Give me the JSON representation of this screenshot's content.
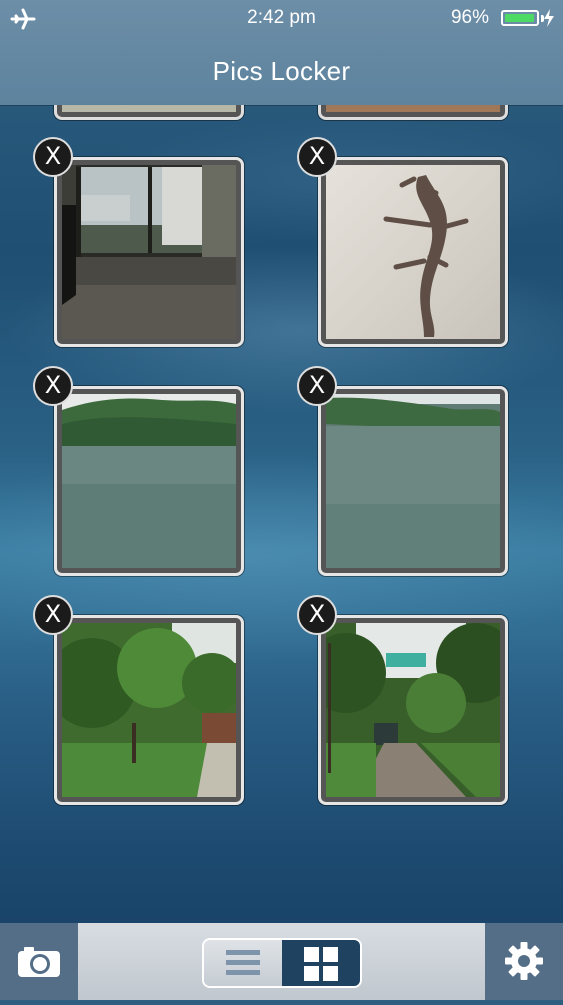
{
  "status_bar": {
    "time": "2:42 pm",
    "battery_percent": "96%",
    "battery_level": 0.96,
    "icons": [
      "airplane-mode-icon",
      "battery-icon",
      "charging-bolt-icon"
    ]
  },
  "nav": {
    "title": "Pics Locker"
  },
  "photos": [
    {
      "label": "room with window",
      "delete_label": "X"
    },
    {
      "label": "gecko on wall",
      "delete_label": "X"
    },
    {
      "label": "lake with hills",
      "delete_label": "X"
    },
    {
      "label": "lake shore",
      "delete_label": "X"
    },
    {
      "label": "garden with trees",
      "delete_label": "X"
    },
    {
      "label": "driveway with car",
      "delete_label": "X"
    }
  ],
  "toolbar": {
    "camera_icon": "camera-icon",
    "list_view_icon": "list-view-icon",
    "grid_view_icon": "grid-view-icon",
    "selected_view": "grid",
    "settings_icon": "gear-icon"
  },
  "colors": {
    "nav_bar": "#6d8ea7",
    "battery_fill": "#4cd964",
    "toolbar_side": "#536e86",
    "segment_selected": "#1f4260"
  }
}
